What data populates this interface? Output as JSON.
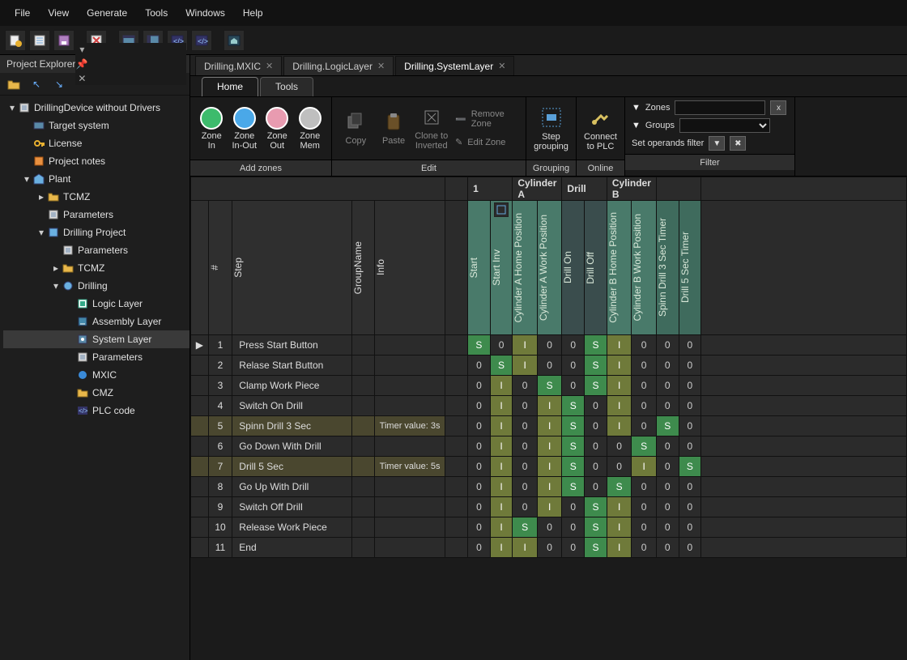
{
  "menu": [
    "File",
    "View",
    "Generate",
    "Tools",
    "Windows",
    "Help"
  ],
  "toolbar_icons": [
    "file-new",
    "file-open",
    "file-save",
    "",
    "file-delete",
    "",
    "panel-a",
    "panel-b",
    "code-a",
    "code-b",
    "",
    "home"
  ],
  "project_explorer": {
    "title": "Project Explorer",
    "tree": {
      "root": "DrillingDevice without Drivers",
      "children": [
        {
          "icon": "target",
          "label": "Target system"
        },
        {
          "icon": "key",
          "label": "License"
        },
        {
          "icon": "notes",
          "label": "Project notes"
        },
        {
          "icon": "plant",
          "label": "Plant",
          "expanded": true,
          "children": [
            {
              "icon": "folder",
              "label": "TCMZ",
              "exp": true
            },
            {
              "icon": "param",
              "label": "Parameters"
            },
            {
              "icon": "proj",
              "label": "Drilling Project",
              "expanded": true,
              "children": [
                {
                  "icon": "param",
                  "label": "Parameters"
                },
                {
                  "icon": "folder",
                  "label": "TCMZ",
                  "exp": true
                },
                {
                  "icon": "drill",
                  "label": "Drilling",
                  "expanded": true,
                  "children": [
                    {
                      "icon": "layer-l",
                      "label": "Logic Layer"
                    },
                    {
                      "icon": "layer-a",
                      "label": "Assembly Layer"
                    },
                    {
                      "icon": "layer-s",
                      "label": "System Layer",
                      "selected": true
                    },
                    {
                      "icon": "param",
                      "label": "Parameters"
                    },
                    {
                      "icon": "mxic",
                      "label": "MXIC"
                    },
                    {
                      "icon": "folder",
                      "label": "CMZ"
                    },
                    {
                      "icon": "code",
                      "label": "PLC code"
                    }
                  ]
                }
              ]
            }
          ]
        }
      ]
    }
  },
  "doc_tabs": [
    {
      "label": "Drilling.MXIC",
      "active": false
    },
    {
      "label": "Drilling.LogicLayer",
      "active": false
    },
    {
      "label": "Drilling.SystemLayer",
      "active": true
    }
  ],
  "subtabs": [
    {
      "label": "Home",
      "active": true
    },
    {
      "label": "Tools",
      "active": false
    }
  ],
  "ribbon": {
    "add_zones": {
      "title": "Add zones",
      "buttons": [
        {
          "label": "Zone\nIn",
          "color": "#3dbb6c"
        },
        {
          "label": "Zone\nIn-Out",
          "color": "#4aa8e8"
        },
        {
          "label": "Zone\nOut",
          "color": "#e89bb0"
        },
        {
          "label": "Zone\nMem",
          "color": "#bfbfbf"
        }
      ]
    },
    "edit": {
      "title": "Edit",
      "buttons": [
        "Copy",
        "Paste",
        "Clone to\nInverted"
      ],
      "small": [
        "Remove Zone",
        "Edit Zone"
      ]
    },
    "grouping": {
      "title": "Grouping",
      "label": "Step\ngrouping"
    },
    "online": {
      "title": "Online",
      "label": "Connect\nto PLC"
    },
    "filter": {
      "title": "Filter",
      "zones": "Zones",
      "groups": "Groups",
      "operands": "Set operands filter",
      "clear": "x"
    }
  },
  "grid": {
    "band_groups": [
      "1",
      "Cylinder A",
      "Drill",
      "Cylinder B"
    ],
    "columns": [
      "Start",
      "Start Inv",
      "Cylinder A Home Position",
      "Cylinder A Work Position",
      "Drill On",
      "Drill Off",
      "Cylinder B Home Position",
      "Cylinder B Work Position",
      "Spinn Drill 3 Sec Timer",
      "Drill 5 Sec Timer"
    ],
    "col_styles": [
      "g",
      "g",
      "g",
      "g",
      "m",
      "m",
      "g",
      "g",
      "g2",
      "g2"
    ],
    "header_labels": {
      "num": "#",
      "step": "Step",
      "group": "GroupName",
      "info": "Info"
    },
    "rows": [
      {
        "n": 1,
        "mark": "▶",
        "step": "Press Start Button",
        "info": "",
        "cells": [
          "S",
          "0",
          "I",
          "0",
          "0",
          "S",
          "I",
          "0",
          "0",
          "0"
        ]
      },
      {
        "n": 2,
        "step": "Relase Start Button",
        "info": "",
        "cells": [
          "0",
          "S",
          "I",
          "0",
          "0",
          "S",
          "I",
          "0",
          "0",
          "0"
        ]
      },
      {
        "n": 3,
        "step": "Clamp Work Piece",
        "info": "",
        "cells": [
          "0",
          "I",
          "0",
          "S",
          "0",
          "S",
          "I",
          "0",
          "0",
          "0"
        ]
      },
      {
        "n": 4,
        "step": "Switch On Drill",
        "info": "",
        "cells": [
          "0",
          "I",
          "0",
          "I",
          "S",
          "0",
          "I",
          "0",
          "0",
          "0"
        ]
      },
      {
        "n": 5,
        "hl": true,
        "step": "Spinn Drill 3 Sec",
        "info": "Timer value: 3s",
        "cells": [
          "0",
          "I",
          "0",
          "I",
          "S",
          "0",
          "I",
          "0",
          "S",
          "0"
        ]
      },
      {
        "n": 6,
        "step": "Go Down With Drill",
        "info": "",
        "cells": [
          "0",
          "I",
          "0",
          "I",
          "S",
          "0",
          "0",
          "S",
          "0",
          "0"
        ]
      },
      {
        "n": 7,
        "hl": true,
        "step": "Drill 5 Sec",
        "info": "Timer value: 5s",
        "cells": [
          "0",
          "I",
          "0",
          "I",
          "S",
          "0",
          "0",
          "I",
          "0",
          "S"
        ]
      },
      {
        "n": 8,
        "step": "Go Up With Drill",
        "info": "",
        "cells": [
          "0",
          "I",
          "0",
          "I",
          "S",
          "0",
          "S",
          "0",
          "0",
          "0"
        ]
      },
      {
        "n": 9,
        "step": "Switch Off Drill",
        "info": "",
        "cells": [
          "0",
          "I",
          "0",
          "I",
          "0",
          "S",
          "I",
          "0",
          "0",
          "0"
        ]
      },
      {
        "n": 10,
        "step": "Release Work Piece",
        "info": "",
        "cells": [
          "0",
          "I",
          "S",
          "0",
          "0",
          "S",
          "I",
          "0",
          "0",
          "0"
        ]
      },
      {
        "n": 11,
        "step": "End",
        "info": "",
        "cells": [
          "0",
          "I",
          "I",
          "0",
          "0",
          "S",
          "I",
          "0",
          "0",
          "0"
        ]
      }
    ]
  }
}
